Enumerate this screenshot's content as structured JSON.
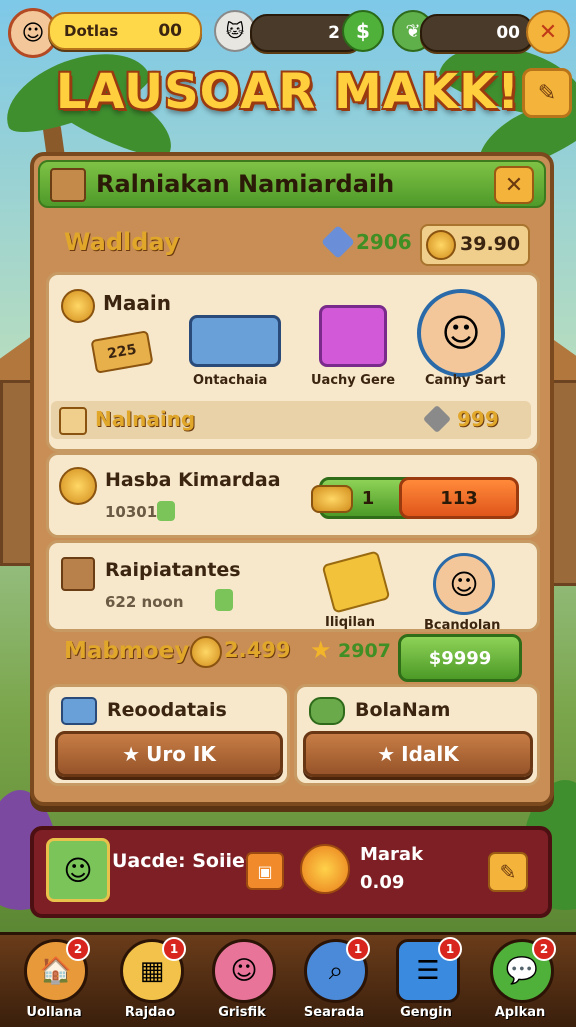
{
  "hud": {
    "player_label": "Dotlas",
    "player_value": "00",
    "gems_value": "2",
    "cash_value": "00"
  },
  "title": "LAUSOAR MAKK!",
  "panel": {
    "header": "Ralniakan Namiardaih",
    "section_label": "Wadlday",
    "stat_value": "2906",
    "coin_value": "39.90",
    "card1": {
      "title": "Maain",
      "ticket": "225",
      "item1_label": "Ontachaia",
      "item2_label": "Uachy Gere",
      "item3_label": "Canhy Sart",
      "footer_label": "Nalnaing",
      "footer_value": "999"
    },
    "card2": {
      "title": "Hasba Kimardaa",
      "sub": "10301",
      "left_btn": "1",
      "right_btn": "113"
    },
    "card3": {
      "title": "Raipiatantes",
      "sub": "622 noon",
      "item_label": "Iliqilan",
      "avatar_label": "Bcandolan",
      "buy_price": "$9999"
    },
    "money_label": "Mabmoey",
    "money_value": "2.499",
    "star_value": "2907",
    "card4": {
      "title": "Reoodatais",
      "btn": "Uro IK"
    },
    "card5": {
      "title": "BolaNam",
      "btn": "IdalK"
    }
  },
  "promo": {
    "title": "Uacde: Soiies",
    "right_title": "Marak",
    "right_value": "0.09"
  },
  "nav": [
    {
      "label": "Uollana",
      "badge": "2"
    },
    {
      "label": "Rajdao",
      "badge": "1"
    },
    {
      "label": "Grisfik",
      "badge": ""
    },
    {
      "label": "Searada",
      "badge": "1"
    },
    {
      "label": "Gengin",
      "badge": "1"
    },
    {
      "label": "Aplkan",
      "badge": "2"
    }
  ],
  "colors": {
    "accent_gold": "#ffcf3d",
    "panel_green": "#4e9a2a",
    "promo_red": "#7d1f24"
  }
}
